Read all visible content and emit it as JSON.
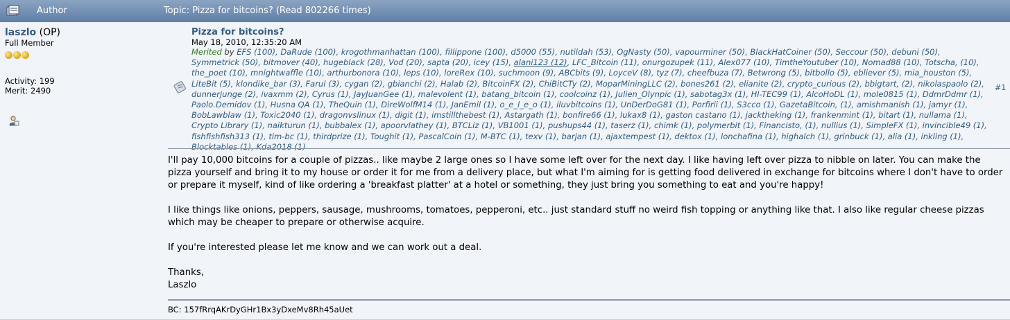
{
  "header": {
    "author_label": "Author",
    "topic_label": "Topic: Pizza for bitcoins?  (Read 802266 times)",
    "icon": "topic-icon"
  },
  "poster": {
    "name": "laszlo",
    "op": " (OP)",
    "rank": "Full Member",
    "activity": "Activity: 199",
    "merit": "Merit: 2490",
    "coins_count": 3,
    "profile_icon": "user-profile-icon"
  },
  "post": {
    "title": "Pizza for bitcoins?",
    "date": "May 18, 2010, 12:35:20 AM",
    "merited_label": "Merited",
    "by_label": " by ",
    "number": "#1",
    "merits": [
      "EFS (100)",
      "DaRude (100)",
      "krogothmanhattan (100)",
      "fillippone (100)",
      "d5000 (55)",
      "nutildah (53)",
      "OgNasty (50)",
      "vapourminer (50)",
      "BlackHatCoiner (50)",
      "Seccour (50)",
      "debuni (50)",
      "Symmetrick (50)",
      "bitmover (40)",
      "hugeblack (28)",
      "Vod (20)",
      "sapta (20)",
      "icey (15)",
      "alani123 (12)",
      "LFC_Bitcoin (11)",
      "onurgozupek (11)",
      "Alex077 (10)",
      "TimtheYoutuber (10)",
      "Nomad88 (10)",
      "Totscha",
      "(10)",
      "the_poet (10)",
      "mnightwaffle (10)",
      "arthurbonora (10)",
      "leps (10)",
      "loreRex (10)",
      "suchmoon (9)",
      "ABCbits (9)",
      "LoyceV (8)",
      "tyz (7)",
      "cheefbuza (7)",
      "Betwrong (5)",
      "bitbollo (5)",
      "ebliever (5)",
      "mia_houston (5)",
      "LiteBit (5)",
      "klondike_bar (3)",
      "Farul (3)",
      "cygan (2)",
      "gbianchi (2)",
      "Halab (2)",
      "BitcoinFX (2)",
      "ChiBitCTy (2)",
      "MoparMiningLLC (2)",
      "bones261 (2)",
      "elianite (2)",
      "crypto_curious (2)",
      "bbigtart",
      "(2)",
      "nikolaspaolo (2)",
      "dunnerjunge (2)",
      "ivaxmm (2)",
      "Cyrus (1)",
      "JayJuanGee (1)",
      "malevolent (1)",
      "batang_bitcoin (1)",
      "coolcoinz (1)",
      "Julien_Olynpic (1)",
      "sabotag3x (1)",
      "HI-TEC99 (1)",
      "AlcoHoDL (1)",
      "mole0815 (1)",
      "DdmrDdmr (1)",
      "Paolo.Demidov (1)",
      "Husna QA (1)",
      "TheQuin (1)",
      "DireWolfM14 (1)",
      "JanEmil (1)",
      "o_e_l_e_o (1)",
      "iluvbitcoins (1)",
      "UnDerDoG81 (1)",
      "Porfirii (1)",
      "S3cco (1)",
      "GazetaBitcoin",
      "(1)",
      "amishmanish (1)",
      "jamyr (1)",
      "BobLawblaw (1)",
      "Toxic2040 (1)",
      "dragonvslinux (1)",
      "digit (1)",
      "imstillthebest (1)",
      "Astargath (1)",
      "bonfire66 (1)",
      "lukax8 (1)",
      "gaston castano (1)",
      "jacktheking (1)",
      "frankenmint (1)",
      "bitart (1)",
      "nullama (1)",
      "Crypto Library (1)",
      "naikturun (1)",
      "bubbalex (1)",
      "apoorvlathey (1)",
      "BTCLiz (1)",
      "VB1001 (1)",
      "pushups44 (1)",
      "taserz (1)",
      "chimk (1)",
      "polymerbit (1)",
      "Financisto",
      "(1)",
      "nullius (1)",
      "SimpleFX (1)",
      "invincible49 (1)",
      "fishfishfish313 (1)",
      "tim-bc (1)",
      "thirdprize (1)",
      "Toughit (1)",
      "PascalCoin (1)",
      "M-BTC (1)",
      "texv (1)",
      "barjan (1)",
      "ajaxtempest (1)",
      "dektox (1)",
      "lonchafina (1)",
      "highalch (1)",
      "grinbuck (1)",
      "alia (1)",
      "inkling (1)",
      "Blocktables (1)",
      "Kda2018 (1)"
    ],
    "body": [
      "I'll pay 10,000 bitcoins for a couple of pizzas.. like maybe 2 large ones so I have some left over for the next day.  I like having left over pizza to nibble on later.  You can make the pizza yourself and bring it to my house or order it for me from a delivery place, but what I'm aiming for is getting food delivered in exchange for bitcoins where I don't have to order or prepare it myself, kind of like ordering a 'breakfast platter' at a hotel or something, they just bring you something to eat and you're happy!",
      "I like things like onions, peppers, sausage, mushrooms, tomatoes, pepperoni, etc.. just standard stuff no weird fish topping or anything like that.  I also like regular cheese pizzas which may be cheaper to prepare or otherwise acquire.",
      "If you're interested please let me know and we can work out a deal."
    ],
    "closing": "Thanks,",
    "closing_name": "Laszlo",
    "signature": "BC: 157fRrqAKrDyGHr1Bx3yDxeMv8Rh45aUet"
  }
}
